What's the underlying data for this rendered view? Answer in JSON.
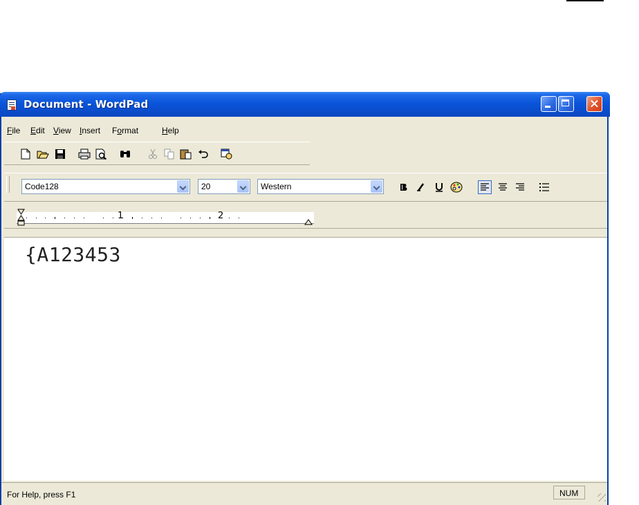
{
  "window": {
    "title": "Document - WordPad"
  },
  "menu": {
    "items": [
      {
        "mnemonic": "F",
        "rest": "ile"
      },
      {
        "mnemonic": "E",
        "rest": "dit"
      },
      {
        "mnemonic": "V",
        "rest": "iew"
      },
      {
        "mnemonic": "I",
        "rest": "nsert"
      },
      {
        "pre": "F",
        "mnemonic": "o",
        "rest": "rmat"
      },
      {
        "mnemonic": "H",
        "rest": "elp"
      }
    ]
  },
  "format_bar": {
    "font_name": "Code128",
    "font_size": "20",
    "script": "Western"
  },
  "ruler": {
    "marks": [
      "1",
      "2"
    ]
  },
  "document": {
    "text": "{A123453"
  },
  "status": {
    "help": "For Help, press F1",
    "num": "NUM"
  },
  "colors": {
    "title_blue": "#0a55d9",
    "chrome": "#ece9d8"
  }
}
